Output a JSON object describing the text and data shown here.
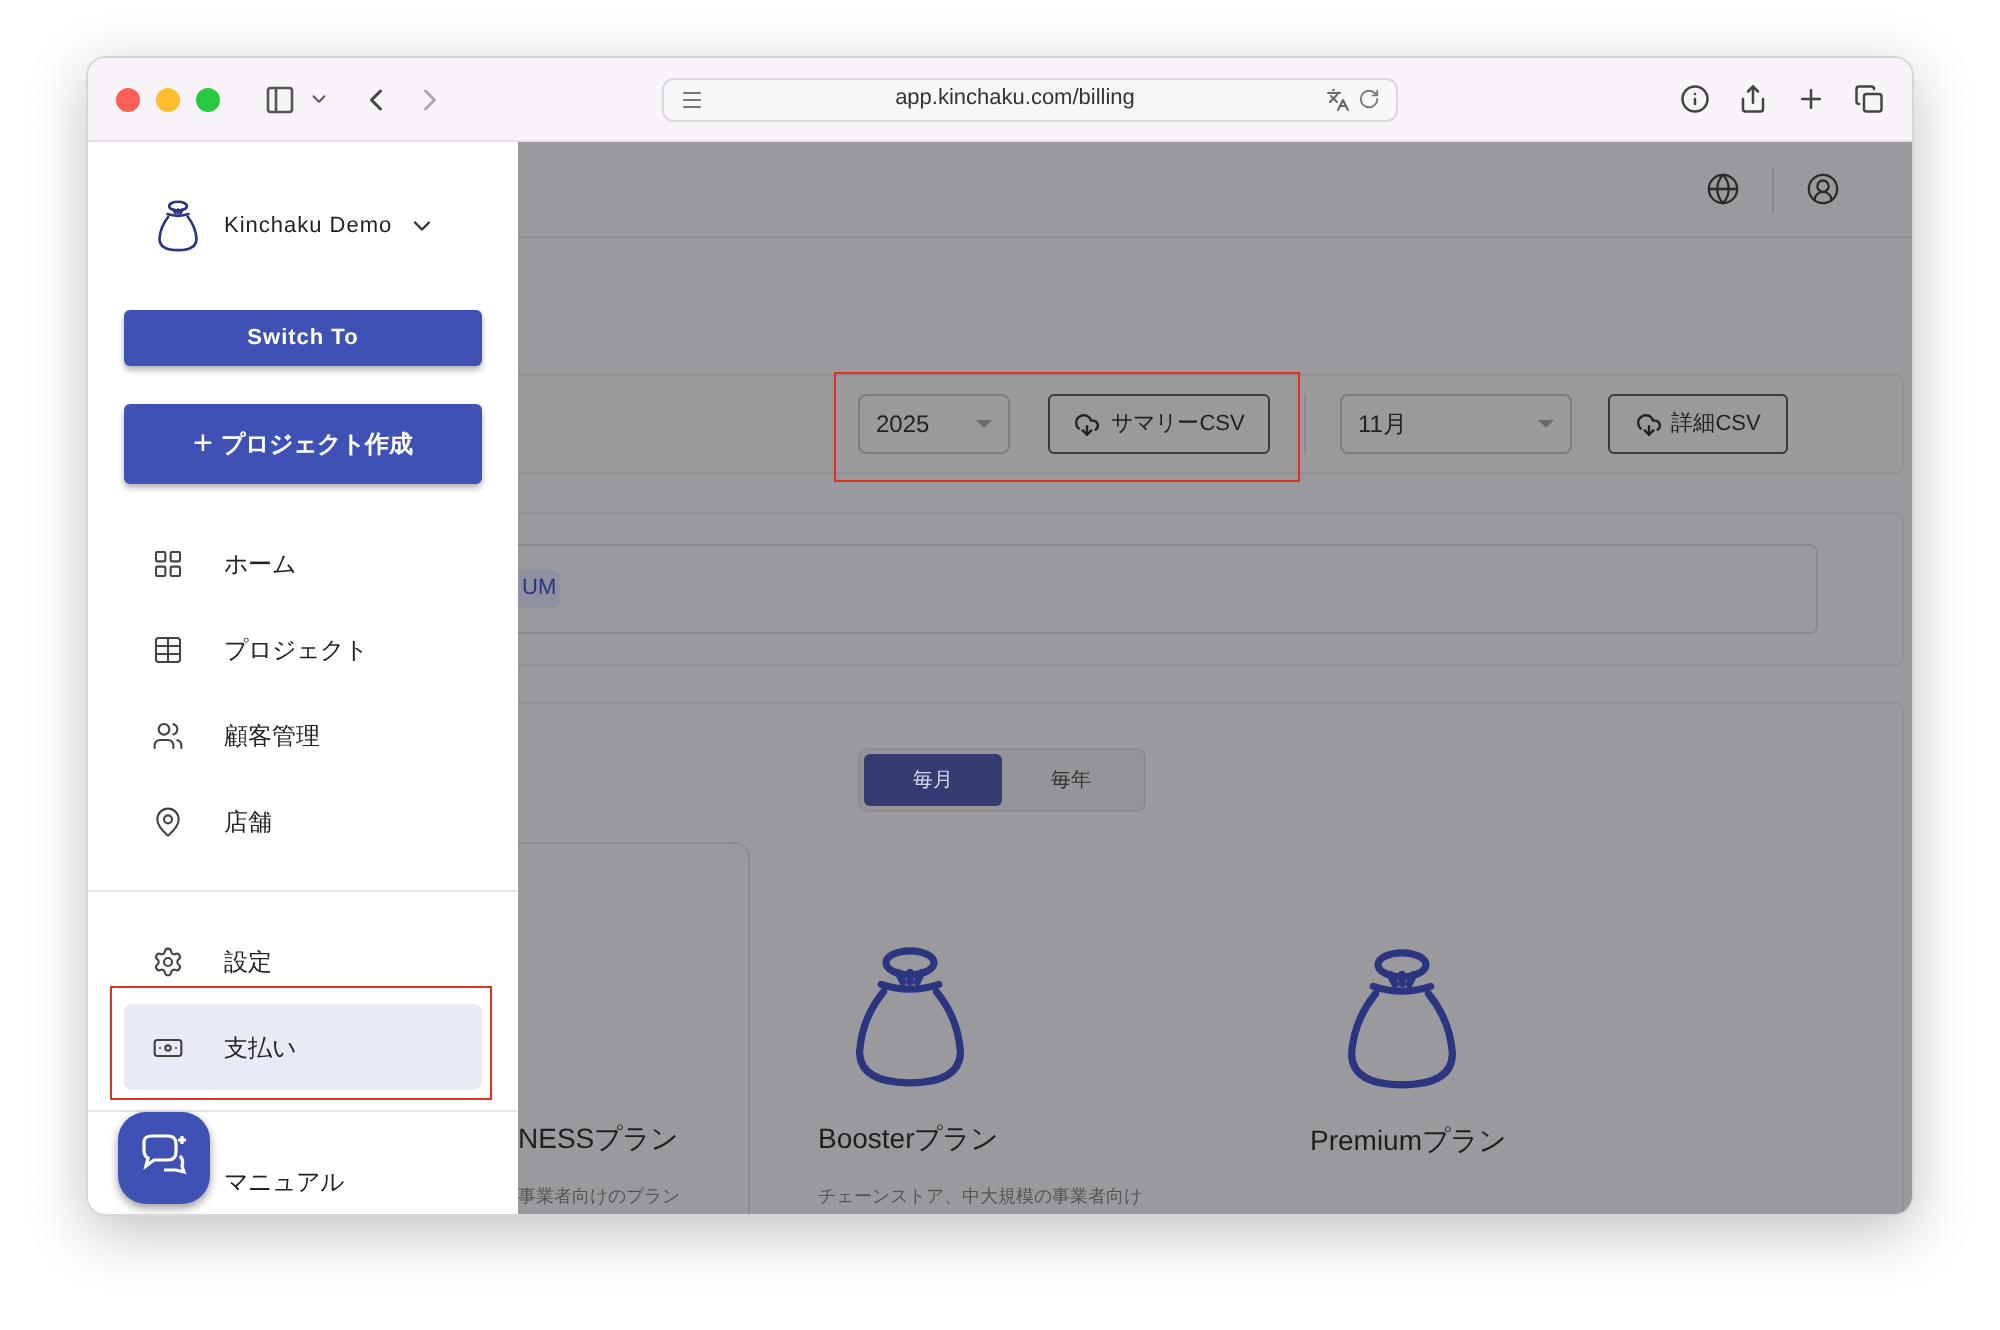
{
  "browser": {
    "url": "app.kinchaku.com/billing"
  },
  "sidebar": {
    "project": "Kinchaku Demo",
    "switch_button": "Switch To",
    "create_button": "プロジェクト作成",
    "create_icon": "+",
    "items": [
      {
        "label": "ホーム",
        "kind": "grid",
        "selected": false
      },
      {
        "label": "プロジェクト",
        "kind": "table",
        "selected": false
      },
      {
        "label": "顧客管理",
        "kind": "people",
        "selected": false
      },
      {
        "label": "店舗",
        "kind": "pin",
        "selected": false
      }
    ],
    "bottom_items": [
      {
        "label": "設定",
        "kind": "gear",
        "selected": false
      },
      {
        "label": "支払い",
        "kind": "money",
        "selected": true
      }
    ],
    "footer_item": "マニュアル"
  },
  "main": {
    "year_select": "2025",
    "summary_csv": "サマリーCSV",
    "month_select": "11月",
    "detail_csv": "詳細CSV",
    "plan_chip": "UM",
    "billing_toggle": [
      {
        "label": "毎月",
        "selected": true
      },
      {
        "label": "毎年",
        "selected": false
      }
    ],
    "plans": [
      {
        "name": "NESSプラン",
        "description": "事業者向けのプラン"
      },
      {
        "name": "Boosterプラン",
        "description": "チェーンストア、中大規模の事業者向け"
      },
      {
        "name": "Premiumプラン"
      }
    ]
  }
}
